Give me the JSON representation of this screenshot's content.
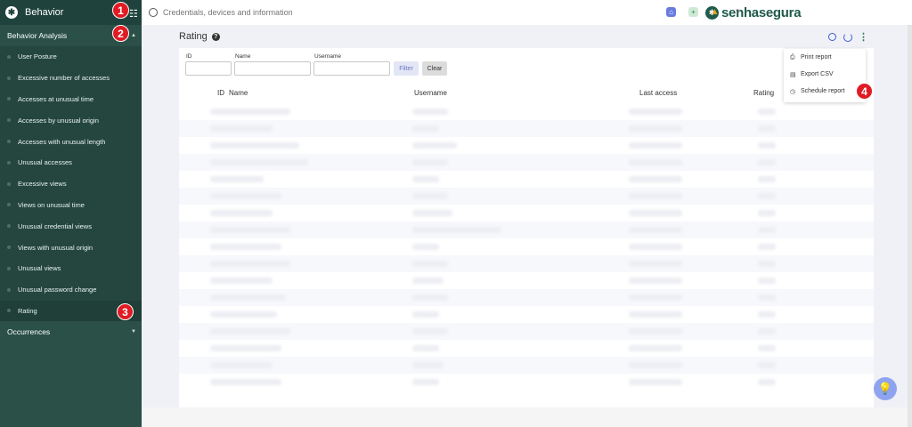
{
  "sidebar": {
    "title": "Behavior",
    "sections": [
      {
        "label": "Behavior Analysis"
      },
      {
        "label": "Occurrences"
      }
    ],
    "items": [
      {
        "label": "User Posture"
      },
      {
        "label": "Excessive number of accesses"
      },
      {
        "label": "Accesses at unusual time"
      },
      {
        "label": "Accesses by unusual origin"
      },
      {
        "label": "Accesses with unusual length"
      },
      {
        "label": "Unusual accesses"
      },
      {
        "label": "Excessive views"
      },
      {
        "label": "Views on unusual time"
      },
      {
        "label": "Unusual credential views"
      },
      {
        "label": "Views with unusual origin"
      },
      {
        "label": "Unusual views"
      },
      {
        "label": "Unusual password change"
      },
      {
        "label": "Rating"
      }
    ]
  },
  "topbar": {
    "search_placeholder": "Credentials, devices and information",
    "brand": "senhasegura"
  },
  "page": {
    "title": "Rating"
  },
  "filters": {
    "id_label": "ID",
    "name_label": "Name",
    "username_label": "Username",
    "filter_button": "Filter",
    "clear_button": "Clear"
  },
  "table": {
    "columns": [
      "ID",
      "Name",
      "Username",
      "Last access",
      "Rating"
    ]
  },
  "dropdown": {
    "items": [
      {
        "label": "Print report",
        "icon": "printer-icon"
      },
      {
        "label": "Export CSV",
        "icon": "file-icon"
      },
      {
        "label": "Schedule report",
        "icon": "clock-icon"
      }
    ]
  },
  "markers": [
    "1",
    "2",
    "3",
    "4"
  ],
  "colors": {
    "sidebar_bg": "#2a5048",
    "brand_green": "#1f5a4a",
    "accent_blue": "#3b5bd6",
    "marker_red": "#e01b24"
  }
}
